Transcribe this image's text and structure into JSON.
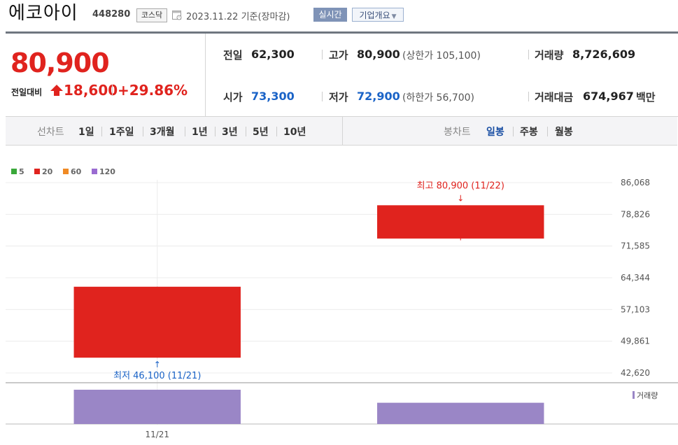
{
  "header": {
    "name": "에코아이",
    "code": "448280",
    "market": "코스닥",
    "base_date": "2023.11.22  기준(장마감)",
    "realtime_label": "실시간",
    "company_label": "기업개요"
  },
  "price": {
    "current": "80,900",
    "change_label": "전일대비",
    "change_amount": "18,600",
    "change_rate": "+29.86%"
  },
  "stats": {
    "prev_label": "전일",
    "prev_value": "62,300",
    "high_label": "고가",
    "high_value": "80,900",
    "upper_limit": "(상한가 105,100)",
    "volume_label": "거래량",
    "volume_value": "8,726,609",
    "open_label": "시가",
    "open_value": "73,300",
    "low_label": "저가",
    "low_value": "72,900",
    "lower_limit": "(하한가 56,700)",
    "amount_label": "거래대금",
    "amount_value": "674,967",
    "amount_unit": "백만"
  },
  "period_bar": {
    "line_chart_title": "선차트",
    "line_periods": [
      "1일",
      "1주일",
      "3개월",
      "1년",
      "3년",
      "5년",
      "10년"
    ],
    "candle_title": "봉차트",
    "candle_periods": [
      "일봉",
      "주봉",
      "월봉"
    ],
    "active_candle": "일봉"
  },
  "colors": {
    "up": "#e0231e",
    "blue": "#1a63c7",
    "volume": "#9a86c6",
    "ma5": "#3aa83a",
    "ma20": "#e0231e",
    "ma60": "#f08a24",
    "ma120": "#9a6bd1"
  },
  "chart_data": {
    "type": "candlestick",
    "legend": [
      {
        "name": "5",
        "color": "#3aa83a"
      },
      {
        "name": "20",
        "color": "#e0231e"
      },
      {
        "name": "60",
        "color": "#f08a24"
      },
      {
        "name": "120",
        "color": "#9a6bd1"
      }
    ],
    "y_ticks": [
      86068,
      78826,
      71585,
      64344,
      57103,
      49861,
      42620
    ],
    "ylim": [
      42620,
      86068
    ],
    "x_tick_labels": [
      "11/21"
    ],
    "candles": [
      {
        "date": "11/21",
        "open": 46100,
        "high": 62300,
        "low": 46100,
        "close": 62300,
        "volume": 1.0
      },
      {
        "date": "11/22",
        "open": 73300,
        "high": 80900,
        "low": 72900,
        "close": 80900,
        "volume": 0.62
      }
    ],
    "annotations": {
      "high": {
        "text": "최고 80,900 (11/22)",
        "value": 80900
      },
      "low": {
        "text": "최저 46,100 (11/21)",
        "value": 46100
      }
    },
    "volume_label": "거래량"
  }
}
